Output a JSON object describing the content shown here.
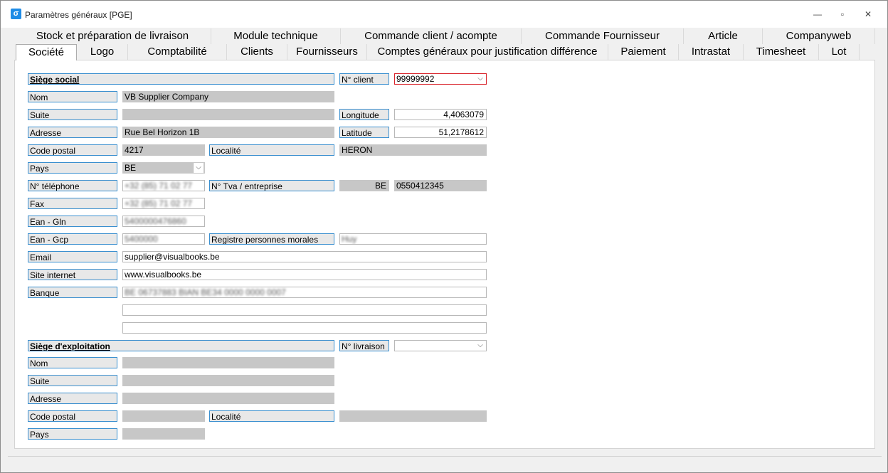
{
  "window": {
    "title": "Paramètres généraux [PGE]",
    "minimize": "—",
    "restore": "▫",
    "close": "✕",
    "app_icon": "σ"
  },
  "tabs_row1": [
    "Stock et préparation de livraison",
    "Module technique",
    "Commande client / acompte",
    "Commande Fournisseur",
    "Article",
    "Companyweb"
  ],
  "tabs_row2": [
    "Société",
    "Logo",
    "Comptabilité",
    "Clients",
    "Fournisseurs",
    "Comptes généraux pour justification différence",
    "Paiement",
    "Intrastat",
    "Timesheet",
    "Lot"
  ],
  "active_tab": "Société",
  "siege_social": {
    "header": "Siège social",
    "nom_label": "Nom",
    "nom": "VB Supplier Company",
    "suite_label": "Suite",
    "suite": "",
    "adresse_label": "Adresse",
    "adresse": "Rue Bel Horizon 1B",
    "cp_label": "Code postal",
    "cp": "4217",
    "localite_label": "Localité",
    "localite": "HERON",
    "pays_label": "Pays",
    "pays": "BE",
    "tel_label": "N° téléphone",
    "tel": "+32 (85) 71 02 77",
    "tva_label": "N° Tva / entreprise",
    "tva_country": "BE",
    "tva": "0550412345",
    "fax_label": "Fax",
    "fax": "+32 (85) 71 02 77",
    "gln_label": "Ean - Gln",
    "gln": "5400000476860",
    "gcp_label": "Ean - Gcp",
    "gcp": "5400000",
    "rpm_label": "Registre personnes morales",
    "rpm": "Huy",
    "email_label": "Email",
    "email": "supplier@visualbooks.be",
    "site_label": "Site internet",
    "site": "www.visualbooks.be",
    "banque_label": "Banque",
    "banque1": "BE 06737883 BIAN BE34 0000 0000 0007",
    "banque2": "",
    "banque3": ""
  },
  "client": {
    "label": "N° client",
    "value": "99999992",
    "longitude_label": "Longitude",
    "longitude": "4,4063079",
    "latitude_label": "Latitude",
    "latitude": "51,2178612"
  },
  "siege_exploitation": {
    "header": "Siège d'exploitation",
    "livraison_label": "N° livraison",
    "livraison": "",
    "nom_label": "Nom",
    "suite_label": "Suite",
    "adresse_label": "Adresse",
    "cp_label": "Code postal",
    "localite_label": "Localité",
    "pays_label": "Pays"
  },
  "icons": {
    "dropdown": "chevron-down-icon"
  }
}
